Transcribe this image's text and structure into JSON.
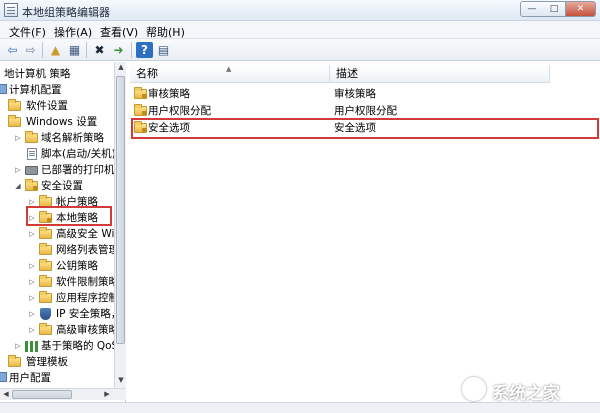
{
  "window": {
    "title": "本地组策略编辑器",
    "min_glyph": "—",
    "max_glyph": "□",
    "close_glyph": "✕"
  },
  "menu": [
    {
      "label": "文件(F)"
    },
    {
      "label": "操作(A)"
    },
    {
      "label": "查看(V)"
    },
    {
      "label": "帮助(H)"
    }
  ],
  "toolbar": {
    "back_glyph": "⇦",
    "forward_glyph": "⇨",
    "up_glyph": "▲",
    "show_hide_glyph": "▦",
    "delete_glyph": "✖",
    "export_glyph": "➜",
    "help_glyph": "?",
    "properties_glyph": "▤"
  },
  "tree": [
    {
      "label": "地计算机 策略"
    },
    {
      "label": "计算机配置"
    },
    {
      "label": "软件设置"
    },
    {
      "label": "Windows 设置"
    },
    {
      "label": "域名解析策略"
    },
    {
      "label": "脚本(启动/关机)"
    },
    {
      "label": "已部署的打印机"
    },
    {
      "label": "安全设置"
    },
    {
      "label": "帐户策略"
    },
    {
      "label": "本地策略"
    },
    {
      "label": "高级安全 Win"
    },
    {
      "label": "网络列表管理"
    },
    {
      "label": "公钥策略"
    },
    {
      "label": "软件限制策略"
    },
    {
      "label": "应用程序控制"
    },
    {
      "label": "IP 安全策略，"
    },
    {
      "label": "高级审核策略"
    },
    {
      "label": "基于策略的 QoS"
    },
    {
      "label": "管理模板"
    },
    {
      "label": "用户配置"
    }
  ],
  "tree_arrows": {
    "collapsed": "▷",
    "expanded": "◢"
  },
  "scroll": {
    "up": "▲",
    "down": "▼",
    "left": "◀",
    "right": "▶"
  },
  "list": {
    "columns": {
      "name": "名称",
      "description": "描述",
      "sort_glyph": "▲"
    },
    "rows": [
      {
        "name": "审核策略",
        "description": "审核策略"
      },
      {
        "name": "用户权限分配",
        "description": "用户权限分配"
      },
      {
        "name": "安全选项",
        "description": "安全选项"
      }
    ]
  },
  "colors": {
    "highlight": "#d33a3a",
    "folder": "#e9b84a"
  }
}
